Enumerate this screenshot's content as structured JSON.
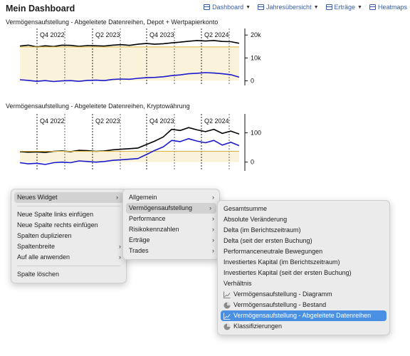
{
  "header": {
    "title": "Mein Dashboard",
    "nav": [
      {
        "label": "Dashboard",
        "icon": "dashboard-icon"
      },
      {
        "label": "Jahresübersicht",
        "icon": "calendar-icon"
      },
      {
        "label": "Erträge",
        "icon": "income-icon"
      },
      {
        "label": "Heatmaps",
        "icon": "heatmap-icon"
      }
    ]
  },
  "charts": {
    "depot_title": "Vermögensaufstellung - Abgeleitete Datenreihen, Depot + Wertpapierkonto",
    "crypto_title": "Vermögensaufstellung - Abgeleitete Datenreihen, Kryptowährung"
  },
  "chart_data": [
    {
      "type": "line",
      "title": "Vermögensaufstellung - Abgeleitete Datenreihen, Depot + Wertpapierkonto",
      "x_period_labels": [
        "Q4 2022",
        "Q2 2023",
        "Q4 2023",
        "Q2 2024"
      ],
      "y_ticks": [
        "20k",
        "10k",
        "0"
      ],
      "ylim": [
        -2000,
        21000
      ],
      "grid": "vertical dashed at quarters",
      "series": [
        {
          "color": "#000000",
          "values": [
            15200,
            15600,
            14800,
            15300,
            15000,
            15600,
            15500,
            15100,
            15400,
            15300,
            15200,
            15600,
            15800,
            15500,
            16000,
            16300,
            16000,
            16200,
            16600,
            16900,
            17300,
            17600,
            17400,
            17600,
            17200,
            17100,
            16400
          ]
        },
        {
          "color": "#d8b43c",
          "values": [
            14800,
            14800,
            14800,
            14800,
            14800,
            14800,
            14800,
            14800,
            14800,
            14800,
            14800,
            14800,
            14800,
            14800,
            14800,
            14800,
            14800,
            14800,
            14800,
            14800,
            14800,
            14800,
            14800,
            14800,
            14800,
            14800,
            14800
          ]
        },
        {
          "color": "#1a1acc",
          "values": [
            500,
            200,
            -200,
            100,
            -300,
            0,
            100,
            -200,
            200,
            300,
            100,
            600,
            800,
            700,
            1100,
            1400,
            1500,
            1800,
            2300,
            2600,
            3100,
            3300,
            3600,
            3400,
            3100,
            2700,
            1600
          ]
        }
      ]
    },
    {
      "type": "line",
      "title": "Vermögensaufstellung - Abgeleitete Datenreihen, Kryptowährung",
      "x_period_labels": [
        "Q4 2022",
        "Q2 2023",
        "Q4 2023",
        "Q2 2024"
      ],
      "y_ticks": [
        "100",
        "0"
      ],
      "ylim": [
        -30,
        150
      ],
      "grid": "vertical dashed at quarters",
      "series": [
        {
          "color": "#000000",
          "values": [
            36,
            34,
            35,
            33,
            37,
            38,
            36,
            40,
            39,
            37,
            38,
            42,
            44,
            46,
            48,
            60,
            72,
            86,
            112,
            108,
            118,
            110,
            104,
            112,
            98,
            106,
            96
          ]
        },
        {
          "color": "#d8b43c",
          "values": [
            37,
            37,
            37,
            37,
            37,
            37,
            37,
            37,
            37,
            37,
            37,
            37,
            37,
            37,
            37,
            37,
            37,
            37,
            37,
            37,
            37,
            37,
            37,
            37,
            37,
            37,
            37
          ]
        },
        {
          "color": "#1a1acc",
          "values": [
            -2,
            -6,
            -4,
            -8,
            -2,
            0,
            -2,
            4,
            2,
            0,
            2,
            6,
            8,
            10,
            12,
            26,
            40,
            52,
            74,
            70,
            80,
            72,
            66,
            74,
            58,
            68,
            56
          ]
        }
      ]
    }
  ],
  "context_menu": {
    "items": [
      {
        "label": "Neues Widget",
        "has_submenu": true
      },
      {
        "label": "Neue Spalte links einfügen"
      },
      {
        "label": "Neue Spalte rechts einfügen"
      },
      {
        "label": "Spalten duplizieren"
      },
      {
        "label": "Spaltenbreite",
        "has_submenu": true
      },
      {
        "label": "Auf alle anwenden",
        "has_submenu": true
      },
      {
        "label": "Spalte löschen"
      }
    ]
  },
  "widget_menu": {
    "items": [
      {
        "label": "Allgemein",
        "has_submenu": true
      },
      {
        "label": "Vermögensaufstellung",
        "has_submenu": true
      },
      {
        "label": "Performance",
        "has_submenu": true
      },
      {
        "label": "Risikokennzahlen",
        "has_submenu": true
      },
      {
        "label": "Erträge",
        "has_submenu": true
      },
      {
        "label": "Trades",
        "has_submenu": true
      }
    ]
  },
  "assets_menu": {
    "items": [
      {
        "label": "Gesamtsumme"
      },
      {
        "label": "Absolute Veränderung"
      },
      {
        "label": "Delta (im Berichtszeitraum)"
      },
      {
        "label": "Delta (seit der ersten Buchung)"
      },
      {
        "label": "Performanceneutrale Bewegungen"
      },
      {
        "label": "Investiertes Kapital (im Berichtszeitraum)"
      },
      {
        "label": "Investiertes Kapital (seit der ersten Buchung)"
      },
      {
        "label": "Verhältnis"
      },
      {
        "label": "Vermögensaufstellung - Diagramm",
        "icon": "line-chart-icon"
      },
      {
        "label": "Vermögensaufstellung - Bestand",
        "icon": "pie-chart-icon"
      },
      {
        "label": "Vermögensaufstellung - Abgeleitete Datenreihen",
        "icon": "line-chart-icon",
        "selected": true
      },
      {
        "label": "Klassifizierungen",
        "icon": "pie-chart-icon"
      }
    ]
  },
  "colors": {
    "accent": "#4a90e2",
    "series_total": "#000000",
    "series_invested": "#d8b43c",
    "series_delta": "#1a1acc",
    "band_fill": "#fbf3d9"
  }
}
